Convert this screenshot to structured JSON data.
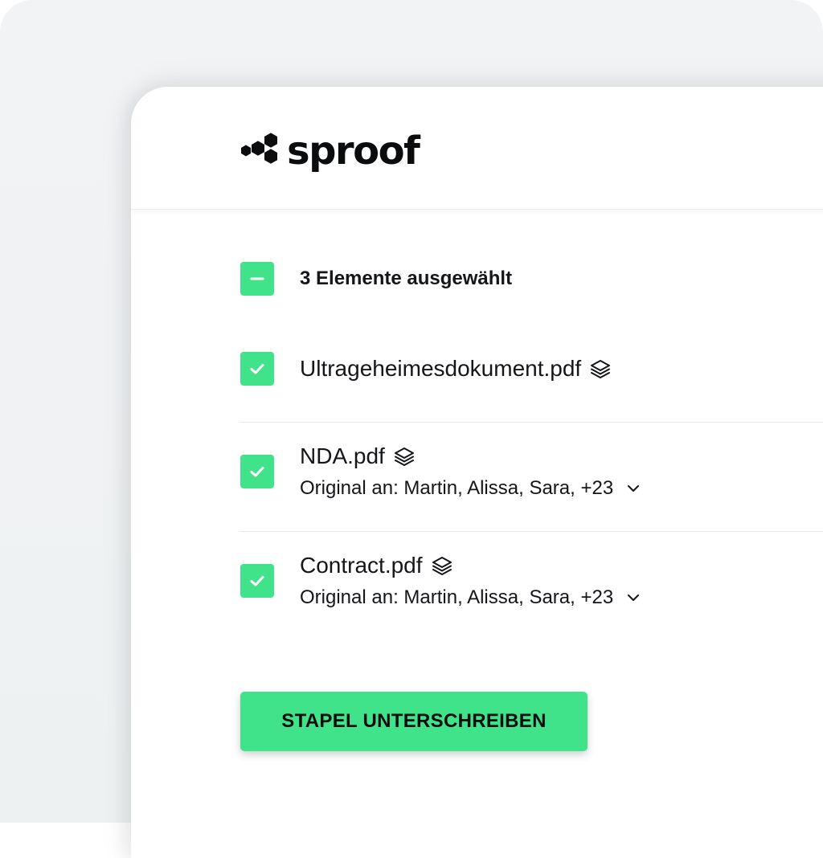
{
  "brand": {
    "name": "sproof",
    "accent_color": "#41e38a",
    "logo_icon": "hexagon-cluster-icon"
  },
  "selection": {
    "label": "3 Elemente ausgewählt",
    "state": "indeterminate"
  },
  "documents": [
    {
      "name": "Ultrageheimesdokument.pdf",
      "icon": "layers-icon",
      "checked": true,
      "recipients": null
    },
    {
      "name": "NDA.pdf",
      "icon": "layers-icon",
      "checked": true,
      "recipients": "Original an: Martin, Alissa, Sara, +23"
    },
    {
      "name": "Contract.pdf",
      "icon": "layers-icon",
      "checked": true,
      "recipients": "Original an: Martin, Alissa, Sara, +23"
    }
  ],
  "actions": {
    "batch_sign_label": "STAPEL UNTERSCHREIBEN"
  }
}
